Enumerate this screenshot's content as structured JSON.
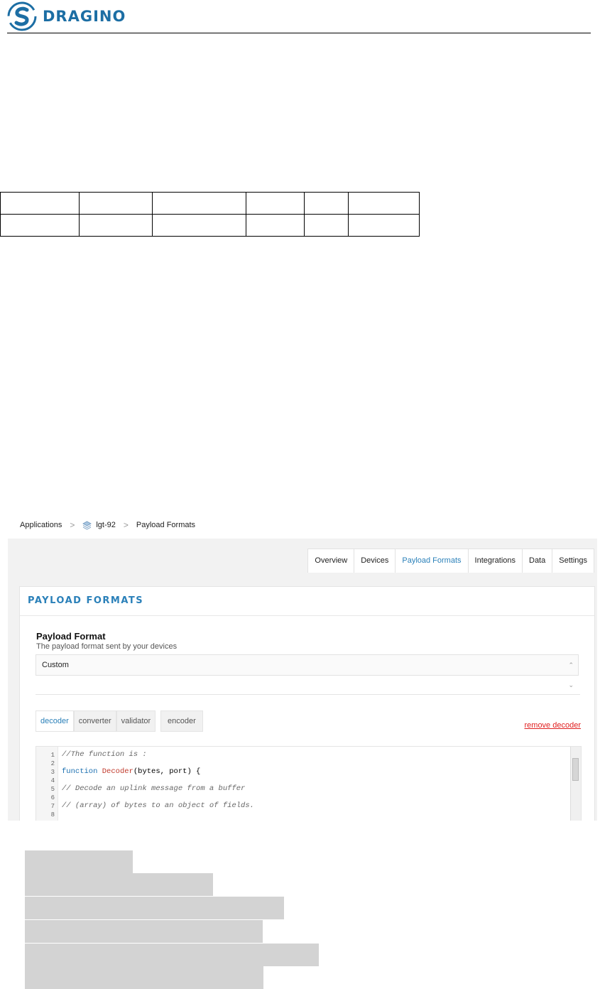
{
  "header": {
    "logo_text": "DRAGINO",
    "brand_color": "#1c6ea4"
  },
  "breadcrumb": {
    "items": [
      "Applications",
      "lgt-92",
      "Payload Formats"
    ],
    "separator": ">"
  },
  "tabs": [
    {
      "label": "Overview",
      "active": false
    },
    {
      "label": "Devices",
      "active": false
    },
    {
      "label": "Payload Formats",
      "active": true
    },
    {
      "label": "Integrations",
      "active": false
    },
    {
      "label": "Data",
      "active": false
    },
    {
      "label": "Settings",
      "active": false
    }
  ],
  "card": {
    "title": "PAYLOAD FORMATS",
    "payload_format_label": "Payload Format",
    "payload_format_desc": "The payload format sent by your devices",
    "selected_format": "Custom",
    "function_tabs": [
      "decoder",
      "converter",
      "validator"
    ],
    "encoder_label": "encoder",
    "remove_label": "remove decoder"
  },
  "editor": {
    "line_numbers": [
      "1",
      "2",
      "3",
      "4",
      "5",
      "6",
      "7",
      "8"
    ],
    "line1": "//The function is :",
    "line3_kw": "function",
    "line3_fn": "Decoder",
    "line3_args": "(bytes, port) {",
    "line5": "// Decode an uplink message from a buffer",
    "line7": "// (array) of bytes to an object of fields."
  },
  "colors": {
    "accent": "#2a80b9",
    "danger": "#e02020",
    "redaction": "#d3d3d3"
  }
}
